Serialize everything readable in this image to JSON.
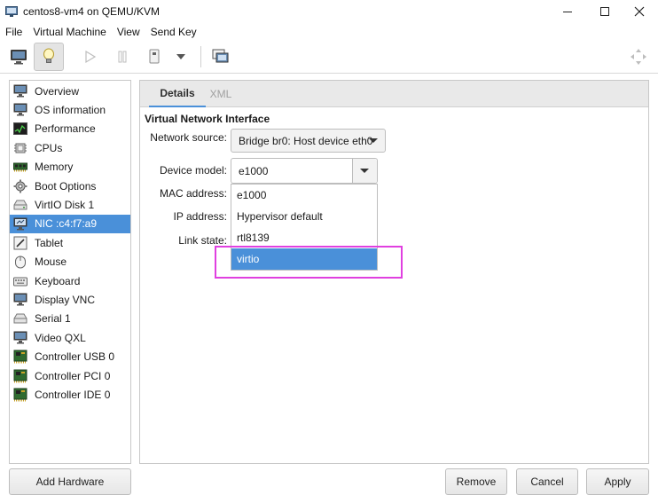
{
  "window": {
    "title": "centos8-vm4 on QEMU/KVM",
    "controls": [
      "minimize-icon",
      "maximize-icon",
      "close-icon"
    ]
  },
  "menubar": {
    "items": [
      {
        "label": "File"
      },
      {
        "label": "Virtual Machine"
      },
      {
        "label": "View"
      },
      {
        "label": "Send Key"
      }
    ]
  },
  "toolbar": {
    "icons": [
      "console-icon",
      "details-lightbulb-icon",
      "run-icon",
      "pause-icon",
      "shutdown-icon",
      "dropdown-arrow-icon",
      "snapshots-icon",
      "fullscreen-icon"
    ]
  },
  "hardware": {
    "items": [
      {
        "label": "Overview",
        "icon": "monitor-icon"
      },
      {
        "label": "OS information",
        "icon": "monitor-icon"
      },
      {
        "label": "Performance",
        "icon": "performance-icon"
      },
      {
        "label": "CPUs",
        "icon": "cpu-icon"
      },
      {
        "label": "Memory",
        "icon": "memory-icon"
      },
      {
        "label": "Boot Options",
        "icon": "gear-icon"
      },
      {
        "label": "VirtIO Disk 1",
        "icon": "disk-icon"
      },
      {
        "label": "NIC :c4:f7:a9",
        "icon": "network-icon",
        "selected": true
      },
      {
        "label": "Tablet",
        "icon": "tablet-icon"
      },
      {
        "label": "Mouse",
        "icon": "mouse-icon"
      },
      {
        "label": "Keyboard",
        "icon": "keyboard-icon"
      },
      {
        "label": "Display VNC",
        "icon": "monitor-icon"
      },
      {
        "label": "Serial 1",
        "icon": "serial-icon"
      },
      {
        "label": "Video QXL",
        "icon": "monitor-icon"
      },
      {
        "label": "Controller USB 0",
        "icon": "controller-icon"
      },
      {
        "label": "Controller PCI 0",
        "icon": "controller-icon"
      },
      {
        "label": "Controller IDE 0",
        "icon": "controller-icon"
      }
    ]
  },
  "tabs": [
    {
      "label": "Details",
      "active": true
    },
    {
      "label": "XML",
      "active": false
    }
  ],
  "details": {
    "section_title": "Virtual Network Interface",
    "network_source_label": "Network source:",
    "network_source_value": "Bridge br0: Host device eth0",
    "device_model_label": "Device model:",
    "device_model_value": "e1000",
    "mac_label": "MAC address:",
    "ip_label": "IP address:",
    "link_state_label": "Link state:",
    "device_model_options": [
      {
        "label": "e1000"
      },
      {
        "label": "Hypervisor default"
      },
      {
        "label": "rtl8139"
      },
      {
        "label": "virtio",
        "highlighted": true
      }
    ]
  },
  "buttons": {
    "add_hardware": "Add Hardware",
    "remove": "Remove",
    "cancel": "Cancel",
    "apply": "Apply"
  },
  "colors": {
    "selection": "#4a90d9",
    "annotation_box": "#e040e0"
  }
}
